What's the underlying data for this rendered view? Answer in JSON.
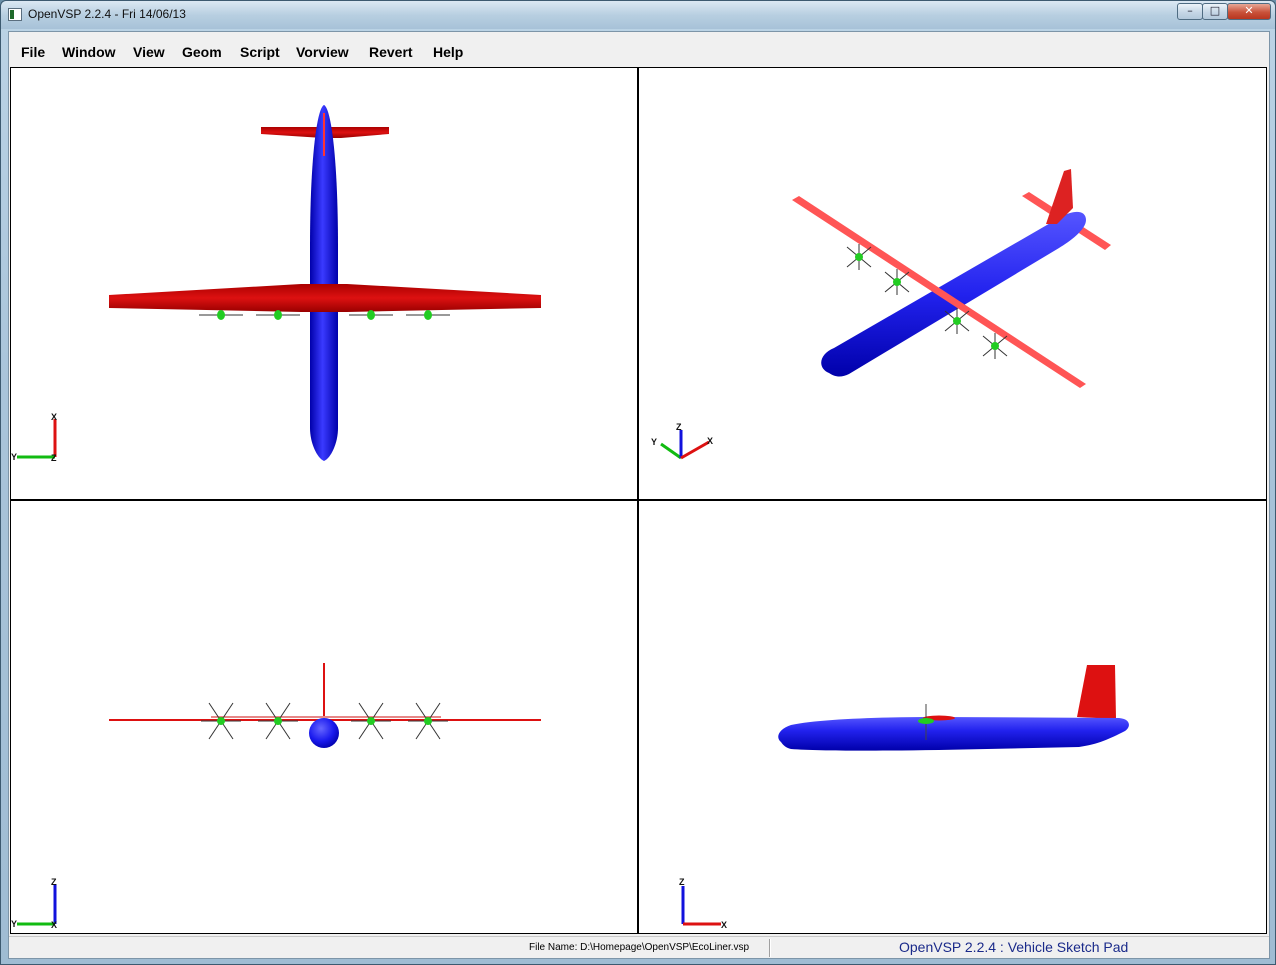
{
  "window": {
    "title": "OpenVSP 2.2.4 - Fri 14/06/13",
    "min_label": "–",
    "max_label": "□",
    "close_label": "✕"
  },
  "menu": [
    {
      "label": "File"
    },
    {
      "label": "Window"
    },
    {
      "label": "View"
    },
    {
      "label": "Geom"
    },
    {
      "label": "Script"
    },
    {
      "label": "Vorview"
    },
    {
      "label": "Revert"
    },
    {
      "label": "Help"
    }
  ],
  "viewports": {
    "top": {
      "axes": [
        "Y",
        "X",
        "Z"
      ]
    },
    "iso": {
      "axes": [
        "Y",
        "Z",
        "X"
      ]
    },
    "front": {
      "axes": [
        "Y",
        "Z",
        "X"
      ]
    },
    "side": {
      "axes": [
        "Z",
        "X"
      ]
    }
  },
  "colors": {
    "fuselage": "#1a1aff",
    "wing": "#cc1111",
    "wing_iso": "#ff5555",
    "prop_hub": "#22cc22",
    "axis_x": "#dd1111",
    "axis_y": "#11bb11",
    "axis_z": "#1111dd"
  },
  "status": {
    "file_name": "File Name: D:\\Homepage\\OpenVSP\\EcoLiner.vsp",
    "caption": "OpenVSP 2.2.4 : Vehicle Sketch Pad"
  }
}
